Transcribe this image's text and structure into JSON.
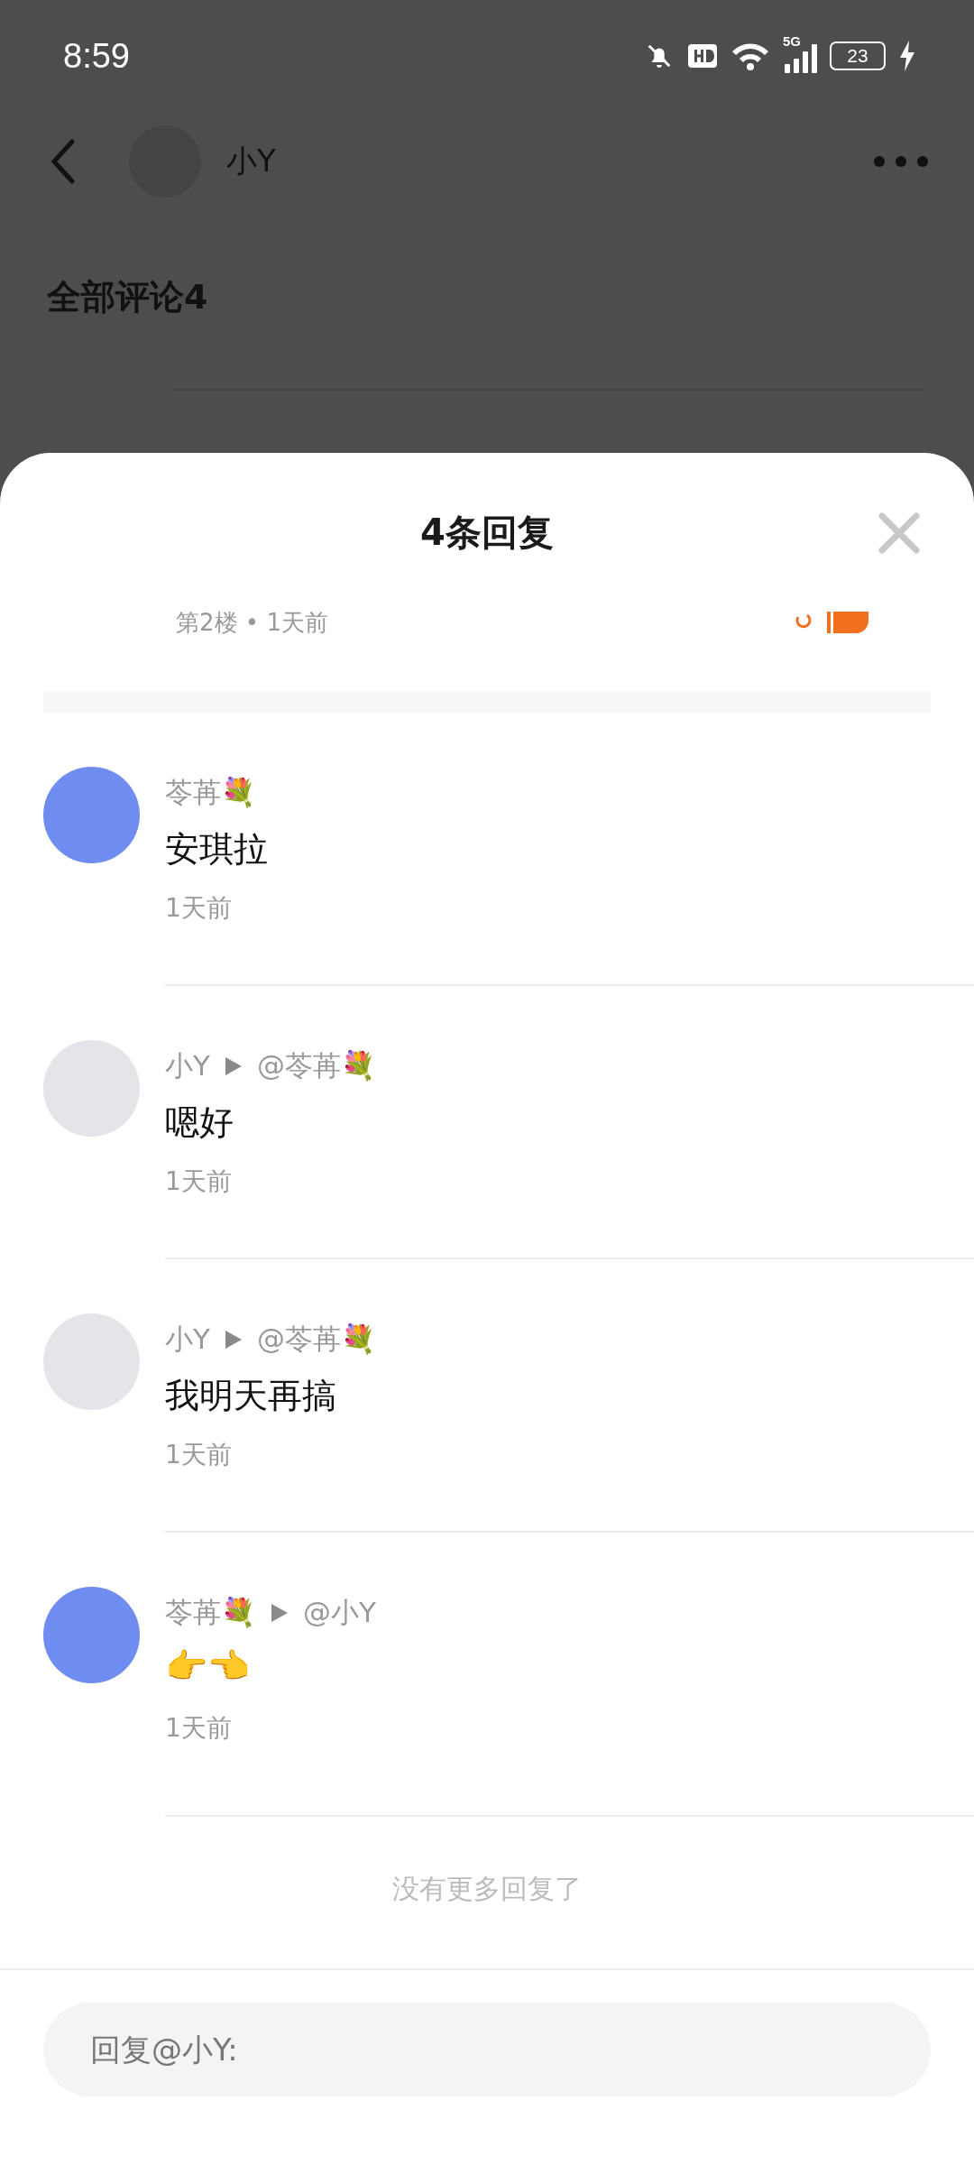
{
  "status_bar": {
    "time": "8:59",
    "battery": "23",
    "network": "5G"
  },
  "header": {
    "username": "小Y"
  },
  "section_title": "全部评论4",
  "sheet": {
    "title": "4条回复",
    "floor_meta": "第2楼 • 1天前"
  },
  "replies": [
    {
      "name": "苓苒💐",
      "content": "安琪拉",
      "time": "1天前",
      "color": "#6f8df0"
    },
    {
      "name": "小Y",
      "reply_to": "@苓苒💐",
      "content": "嗯好",
      "time": "1天前",
      "color": "#e6e4e8"
    },
    {
      "name": "小Y",
      "reply_to": "@苓苒💐",
      "content": "我明天再搞",
      "time": "1天前",
      "color": "#e6e4e8"
    },
    {
      "name": "苓苒💐",
      "reply_to": "@小Y",
      "content": "👉👈",
      "time": "1天前",
      "color": "#6f8df0"
    }
  ],
  "end_note": "没有更多回复了",
  "reply_input": {
    "placeholder": "回复@小Y:"
  }
}
